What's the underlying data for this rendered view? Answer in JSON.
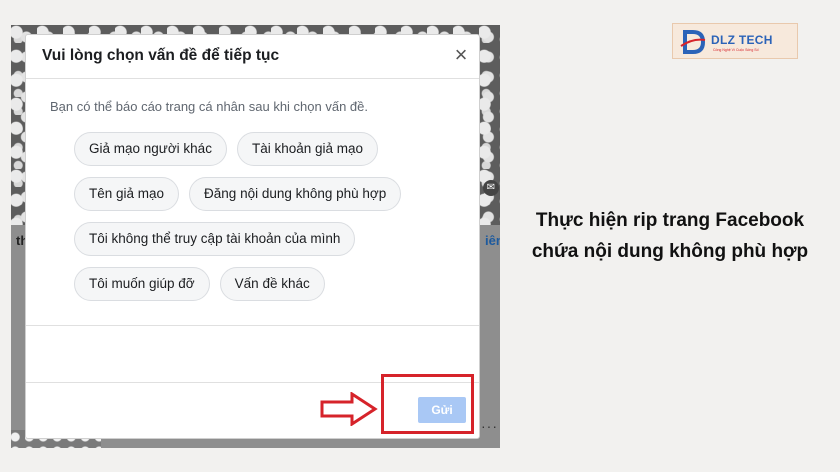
{
  "dialog": {
    "title": "Vui lòng chọn vấn đề để tiếp tục",
    "close_glyph": "×",
    "subtitle": "Bạn có thể báo cáo trang cá nhân sau khi chọn vấn đề.",
    "options": [
      "Giả mạo người khác",
      "Tài khoản giả mạo",
      "Tên giả mạo",
      "Đăng nội dung không phù hợp",
      "Tôi không thể truy cập tài khoản của mình",
      "Tôi muốn giúp đỡ",
      "Vấn đề khác"
    ],
    "send_label": "Gửi"
  },
  "background": {
    "left_fragment": "th",
    "right_fragment": "iêm"
  },
  "logo": {
    "text": "DLZ TECH",
    "tagline": "Công Nghệ Vì Cuộc Sống Số"
  },
  "caption": {
    "line1": "Thực hiện rip trang Facebook",
    "line2": "chứa nội dung không phù hợp"
  },
  "colors": {
    "highlight": "#d6232a",
    "send_button": "#a9c8f5",
    "brand_blue": "#2b63b8"
  }
}
